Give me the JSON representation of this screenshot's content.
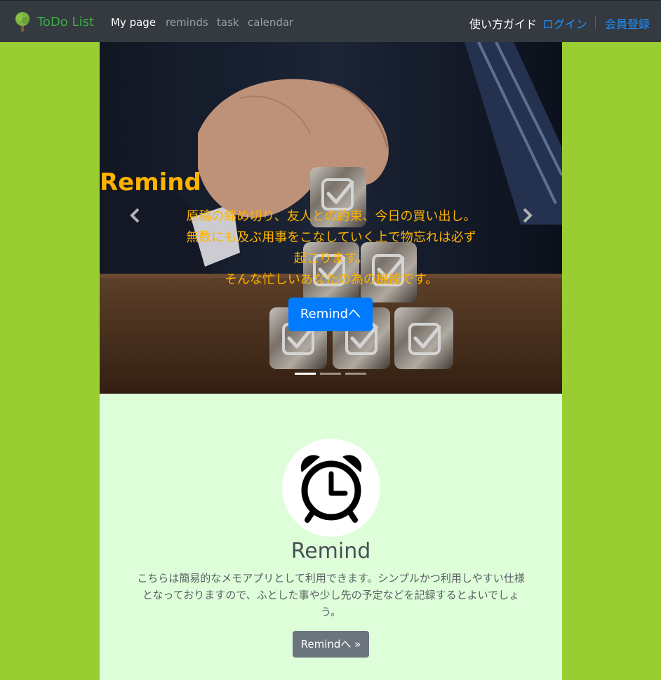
{
  "navbar": {
    "brand": "ToDo List",
    "links": [
      "My page",
      "reminds",
      "task",
      "calendar"
    ],
    "guide": "使い方ガイド",
    "login": "ログイン",
    "register": "会員登録"
  },
  "carousel": {
    "title": "Remind",
    "text_lines": [
      "原稿の締め切り、友人との約束、今日の買い出し。",
      "無数にも及ぶ用事をこなしていく上で物忘れは必ず",
      "起こります。",
      "そんな忙しいあなたの為の機能です。"
    ],
    "button": "Remindへ",
    "indicators": 3,
    "active_indicator": 0
  },
  "feature": {
    "title": "Remind",
    "text_lines": [
      "こちらは簡易的なメモアプリとして利用できます。シンプルかつ利用しやすい仕様",
      "となっておりますので、ふとした事や少し先の予定などを記録するとよいでしょ",
      "う。"
    ],
    "button": "Remindへ »",
    "icon": "alarm-clock-icon"
  },
  "colors": {
    "navbar_bg": "#343a40",
    "page_bg": "#9acd32",
    "feature_bg": "#defed9",
    "caption_color": "#ffb300",
    "primary": "#007bff",
    "secondary": "#6c757d",
    "brand_green": "#3cb043"
  }
}
